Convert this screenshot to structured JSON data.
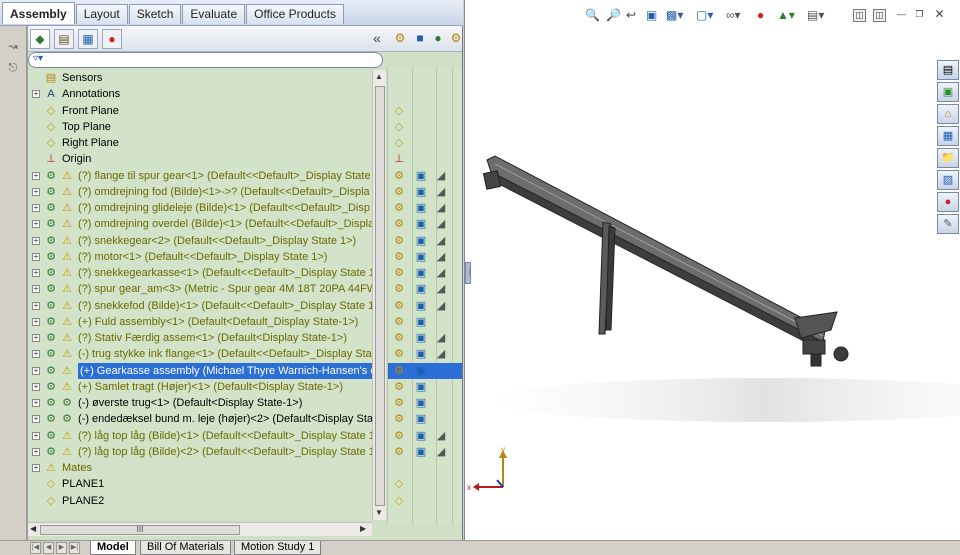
{
  "top_tabs": [
    "Assembly",
    "Layout",
    "Sketch",
    "Evaluate",
    "Office Products"
  ],
  "tree": [
    {
      "label": "Sensors",
      "icon": "sensor-icon",
      "exp": false
    },
    {
      "label": "Annotations",
      "icon": "annotation-icon",
      "exp": true
    },
    {
      "label": "Front Plane",
      "icon": "plane-icon",
      "exp": false
    },
    {
      "label": "Top Plane",
      "icon": "plane-icon",
      "exp": false
    },
    {
      "label": "Right Plane",
      "icon": "plane-icon",
      "exp": false
    },
    {
      "label": "Origin",
      "icon": "origin-icon",
      "exp": false
    },
    {
      "label": "(?) flange til spur gear<1> (Default<<Default>_Display State 1",
      "icon": "warning-part-icon",
      "exp": true,
      "olive": true
    },
    {
      "label": "(?) omdrejning fod (Bilde)<1>->? (Default<<Default>_Displa",
      "icon": "warning-part-icon",
      "exp": true,
      "olive": true
    },
    {
      "label": "(?) omdrejning glideleje (Bilde)<1> (Default<<Default>_Disp",
      "icon": "warning-part-icon",
      "exp": true,
      "olive": true
    },
    {
      "label": "(?) omdrejning overdel (Bilde)<1> (Default<<Default>_Displa",
      "icon": "warning-part-icon",
      "exp": true,
      "olive": true
    },
    {
      "label": "(?) snekkegear<2> (Default<<Default>_Display State 1>)",
      "icon": "warning-part-icon",
      "exp": true,
      "olive": true
    },
    {
      "label": "(?) motor<1> (Default<<Default>_Display State 1>)",
      "icon": "warning-part-icon",
      "exp": true,
      "olive": true
    },
    {
      "label": "(?) snekkegearkasse<1> (Default<<Default>_Display State 1>",
      "icon": "warning-part-icon",
      "exp": true,
      "olive": true
    },
    {
      "label": "(?) spur gear_am<3> (Metric - Spur gear 4M 18T 20PA 44FW -",
      "icon": "warning-part-icon",
      "exp": true,
      "olive": true
    },
    {
      "label": "(?) snekkefod (Bilde)<1> (Default<<Default>_Display State 1:",
      "icon": "warning-part-icon",
      "exp": true,
      "olive": true
    },
    {
      "label": "(+) Fuld assembly<1> (Default<Default_Display State-1>)",
      "icon": "warning-assembly-icon",
      "exp": true,
      "olive": true
    },
    {
      "label": "(?) Stativ Færdig assem<1> (Default<Display State-1>)",
      "icon": "warning-assembly-icon",
      "exp": true,
      "olive": true
    },
    {
      "label": "(-) trug stykke ink flange<1> (Default<<Default>_Display Sta",
      "icon": "warning-assembly-icon",
      "exp": true,
      "olive": true
    },
    {
      "label": "(+) Gearkasse assembly (Michael Thyre Warnich-Hansen's co",
      "icon": "warning-assembly-icon",
      "exp": true,
      "selected": true
    },
    {
      "label": "(+) Samlet tragt (Højer)<1> (Default<Display State-1>)",
      "icon": "warning-assembly-icon",
      "exp": true,
      "olive": true
    },
    {
      "label": "(-) øverste trug<1> (Default<Display State-1>)",
      "icon": "assembly-icon",
      "exp": true
    },
    {
      "label": "(-) endedæksel bund m. leje (højer)<2> (Default<Display Sta",
      "icon": "assembly-icon",
      "exp": true
    },
    {
      "label": "(?) låg top låg (Bilde)<1> (Default<<Default>_Display State 1",
      "icon": "warning-part-icon",
      "exp": true,
      "olive": true
    },
    {
      "label": "(?) låg top låg (Bilde)<2> (Default<<Default>_Display State 1",
      "icon": "warning-part-icon",
      "exp": true,
      "olive": true
    },
    {
      "label": "Mates",
      "icon": "mates-icon",
      "exp": true,
      "olive": true
    },
    {
      "label": "PLANE1",
      "icon": "plane-icon",
      "exp": false
    },
    {
      "label": "PLANE2",
      "icon": "plane-icon",
      "exp": false
    }
  ],
  "hscroll_label": "III",
  "bottom_tabs": [
    "Model",
    "Bill Of Materials",
    "Motion Study 1"
  ],
  "colors": {
    "accent": "#2b6fd6",
    "tree_bg": "#d2e3c9",
    "olive_text": "#6b6a00"
  }
}
